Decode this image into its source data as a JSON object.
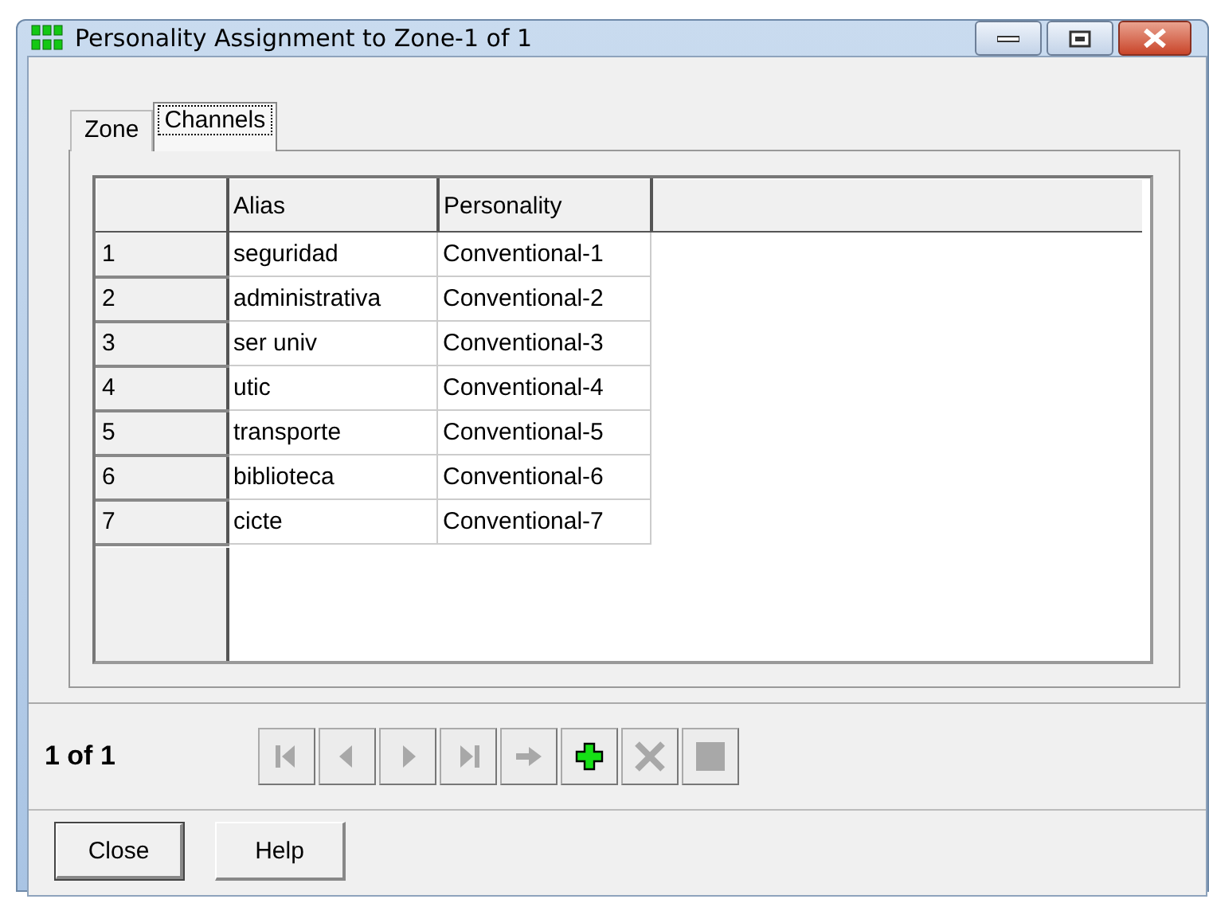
{
  "window": {
    "title": "Personality Assignment to Zone-1 of 1"
  },
  "tabs": [
    {
      "label": "Zone",
      "selected": false
    },
    {
      "label": "Channels",
      "selected": true
    }
  ],
  "table": {
    "columns": [
      "Alias",
      "Personality"
    ],
    "rows": [
      {
        "number": "1",
        "alias": "seguridad",
        "personality": "Conventional-1"
      },
      {
        "number": "2",
        "alias": "administrativa",
        "personality": "Conventional-2"
      },
      {
        "number": "3",
        "alias": "ser univ",
        "personality": "Conventional-3"
      },
      {
        "number": "4",
        "alias": "utic",
        "personality": "Conventional-4"
      },
      {
        "number": "5",
        "alias": "transporte",
        "personality": "Conventional-5"
      },
      {
        "number": "6",
        "alias": "biblioteca",
        "personality": "Conventional-6"
      },
      {
        "number": "7",
        "alias": "cicte",
        "personality": "Conventional-7"
      }
    ]
  },
  "navigator": {
    "position": "1 of 1",
    "buttons": [
      {
        "kind": "first",
        "disabled": true
      },
      {
        "kind": "prev",
        "disabled": true
      },
      {
        "kind": "next",
        "disabled": true
      },
      {
        "kind": "last",
        "disabled": true
      },
      {
        "kind": "goto",
        "disabled": true
      },
      {
        "kind": "add",
        "disabled": false
      },
      {
        "kind": "delete",
        "disabled": true
      },
      {
        "kind": "stop",
        "disabled": true
      }
    ]
  },
  "buttons": [
    {
      "label": "Close",
      "default": true
    },
    {
      "label": "Help",
      "default": false
    }
  ]
}
